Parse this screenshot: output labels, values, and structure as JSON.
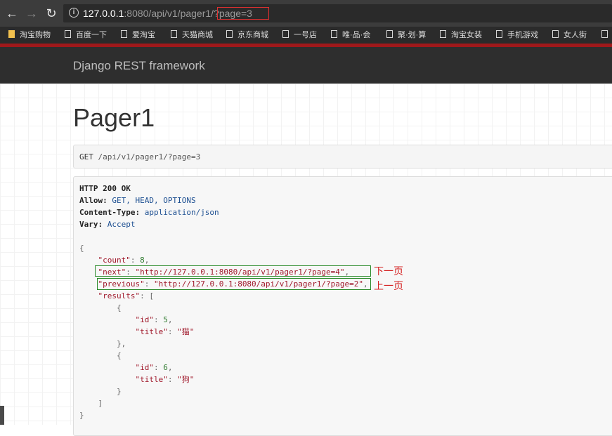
{
  "browser": {
    "back_glyph": "←",
    "forward_glyph": "→",
    "reload_glyph": "↻",
    "url_host": "127.0.0.1",
    "url_rest": ":8080/api/v1/pager1/",
    "url_query": "?page=3",
    "highlight_color": "#e03030",
    "bookmarks": [
      "淘宝购物",
      "百度一下",
      "爱淘宝",
      "天猫商城",
      "京东商城",
      "一号店",
      "唯·品·会",
      "聚·划·算",
      "淘宝女装",
      "手机游戏",
      "女人街"
    ]
  },
  "drf": {
    "brand": "Django REST framework",
    "title": "Pager1",
    "request": {
      "method": "GET",
      "path": "/api/v1/pager1/?page=3"
    },
    "response": {
      "status": "HTTP 200 OK",
      "headers": [
        {
          "name": "Allow:",
          "value": "GET, HEAD, OPTIONS"
        },
        {
          "name": "Content-Type:",
          "value": "application/json"
        },
        {
          "name": "Vary:",
          "value": "Accept"
        }
      ],
      "body": {
        "open_brace": "{",
        "count_key": "\"count\"",
        "count_value": "8",
        "next_key": "\"next\"",
        "next_value": "\"http://127.0.0.1:8080/api/v1/pager1/?page=4\"",
        "previous_key": "\"previous\"",
        "previous_value": "\"http://127.0.0.1:8080/api/v1/pager1/?page=2\"",
        "results_key": "\"results\"",
        "results_open": "[",
        "items": [
          {
            "id_key": "\"id\"",
            "id": "5",
            "title_key": "\"title\"",
            "title": "\"猫\""
          },
          {
            "id_key": "\"id\"",
            "id": "6",
            "title_key": "\"title\"",
            "title": "\"狗\""
          }
        ],
        "results_close": "]",
        "close_brace": "}"
      }
    }
  },
  "annotations": {
    "next_label": "下一页",
    "previous_label": "上一页",
    "box_color": "#2a8a2a",
    "text_color": "#d42020"
  }
}
